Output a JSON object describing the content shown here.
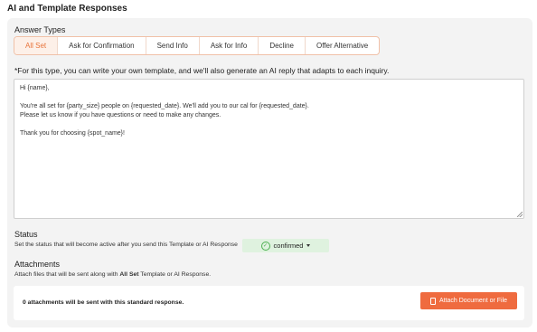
{
  "section": {
    "title": "AI and Template Responses"
  },
  "answer_types": {
    "heading": "Answer Types",
    "tabs": [
      {
        "label": "All Set",
        "active": true
      },
      {
        "label": "Ask for Confirmation",
        "active": false
      },
      {
        "label": "Send Info",
        "active": false
      },
      {
        "label": "Ask for Info",
        "active": false
      },
      {
        "label": "Decline",
        "active": false
      },
      {
        "label": "Offer Alternative",
        "active": false
      }
    ],
    "hint": "*For this type, you can write your own template, and we'll also generate an AI reply that adapts to each inquiry."
  },
  "template": {
    "value": "Hi {name},\n\nYou're all set for {party_size} people on {requested_date}. We'll add you to our cal for {requested_date}.\nPlease let us know if you have questions or need to make any changes.\n\nThank you for choosing {spot_name}!"
  },
  "status": {
    "heading": "Status",
    "description": "Set the status that will become active after you send this Template or AI Response",
    "value": "confirmed",
    "icon": "check-circle-icon",
    "badge_color": "#dff2df"
  },
  "attachments": {
    "heading": "Attachments",
    "description_prefix": "Attach files that will be sent along with ",
    "description_bold": "All Set",
    "description_suffix": " Template or AI Response.",
    "count_text": "0 attachments will be sent with this standard response.",
    "button_label": "Attach Document or File",
    "button_color": "#ef6b3f"
  }
}
